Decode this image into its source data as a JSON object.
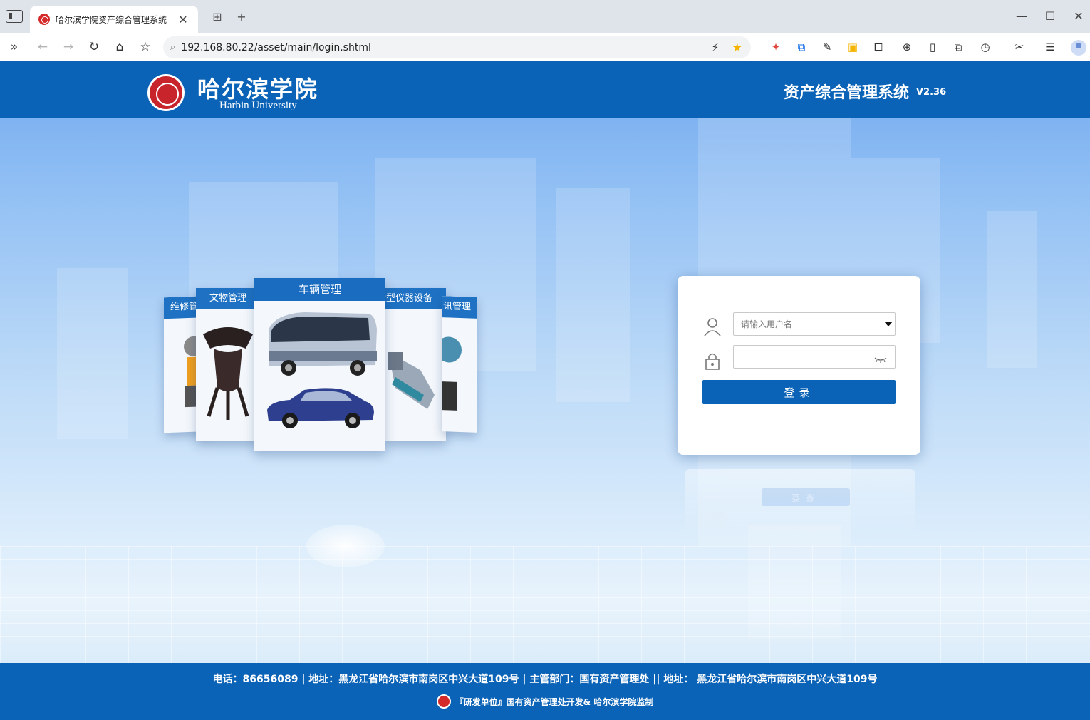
{
  "browser": {
    "tab_title": "哈尔滨学院资产综合管理系统",
    "tab_close": "✕",
    "new_tab": "+",
    "url": "192.168.80.22/asset/main/login.shtml",
    "window_controls": {
      "minimize": "—",
      "maximize": "☐",
      "close": "✕"
    }
  },
  "header": {
    "school_name_cn": "哈尔滨学院",
    "school_name_en": "Harbin University",
    "system_title": "资产综合管理系统",
    "system_version": "V2.36"
  },
  "cards": {
    "far_left": "维修管理",
    "left": "文物管理",
    "center": "车辆管理",
    "right": "大型仪器设备",
    "far_right": "通讯管理"
  },
  "login": {
    "username_placeholder": "请输入用户名",
    "password_value": "",
    "submit_label": "登录",
    "reflection_label": "登录"
  },
  "footer": {
    "info": "电话：86656089 | 地址：黑龙江省哈尔滨市南岗区中兴大道109号 | 主管部门：国有资产管理处  ||  地址：  黑龙江省哈尔滨市南岗区中兴大道109号",
    "credit": "『研发单位』国有资产管理处开发& 哈尔滨学院监制"
  },
  "colors": {
    "brand_blue": "#0b63b7",
    "emblem_red": "#c8242c"
  }
}
